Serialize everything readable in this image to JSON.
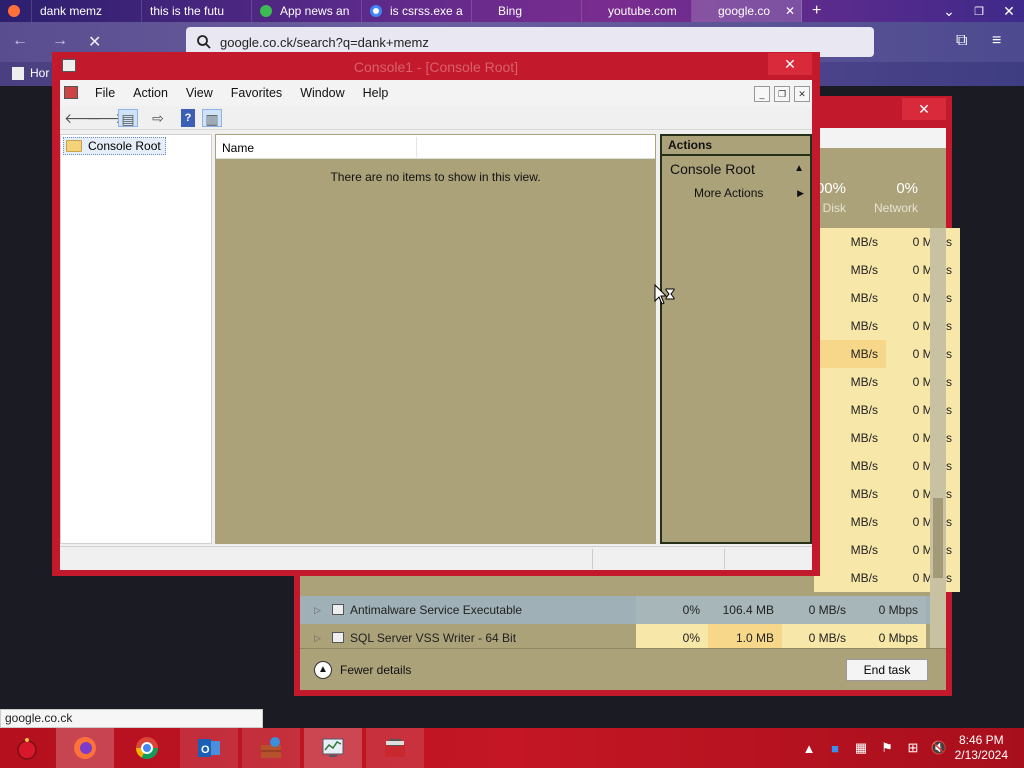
{
  "browser": {
    "tabs": [
      {
        "label": "",
        "icon": "firefox-icon",
        "color": "#ff7139"
      },
      {
        "label": "dank memz",
        "icon": "",
        "color": ""
      },
      {
        "label": "this is the futu",
        "icon": "",
        "color": ""
      },
      {
        "label": "App news an",
        "icon": "app-icon",
        "color": "#3cba54"
      },
      {
        "label": "is csrss.exe a",
        "icon": "google-icon",
        "color": "#4285f4"
      },
      {
        "label": "Bing",
        "icon": "",
        "color": ""
      },
      {
        "label": "youtube.com",
        "icon": "",
        "color": ""
      },
      {
        "label": "google.co",
        "icon": "",
        "color": "",
        "close": "✕"
      }
    ],
    "new_tab": "+",
    "url": "google.co.ck/search?q=dank+memz",
    "bookmark_label": "Hor",
    "status_url": "google.co.ck"
  },
  "task_manager": {
    "close": "✕",
    "columns": [
      {
        "value": "00%",
        "label": "Disk"
      },
      {
        "value": "0%",
        "label": "Network"
      }
    ],
    "partial_rows": [
      {
        "disk": "MB/s",
        "net": "0 Mbps"
      },
      {
        "disk": "MB/s",
        "net": "0 Mbps"
      },
      {
        "disk": "MB/s",
        "net": "0 Mbps"
      },
      {
        "disk": "MB/s",
        "net": "0 Mbps"
      },
      {
        "disk": "MB/s",
        "net": "0 Mbps"
      },
      {
        "disk": "MB/s",
        "net": "0 Mbps"
      },
      {
        "disk": "MB/s",
        "net": "0 Mbps"
      },
      {
        "disk": "MB/s",
        "net": "0 Mbps"
      },
      {
        "disk": "MB/s",
        "net": "0 Mbps"
      },
      {
        "disk": "MB/s",
        "net": "0 Mbps"
      },
      {
        "disk": "MB/s",
        "net": "0 Mbps"
      },
      {
        "disk": "MB/s",
        "net": "0 Mbps"
      },
      {
        "disk": "MB/s",
        "net": "0 Mbps"
      }
    ],
    "full_rows": [
      {
        "name": "Antimalware Service Executable",
        "cpu": "0%",
        "memory": "106.4 MB",
        "disk": "0 MB/s",
        "network": "0 Mbps"
      },
      {
        "name": "SQL Server VSS Writer - 64 Bit",
        "cpu": "0%",
        "memory": "1.0 MB",
        "disk": "0 MB/s",
        "network": "0 Mbps"
      }
    ],
    "fewer_details": "Fewer details",
    "end_task": "End task"
  },
  "console": {
    "title": "Console1 - [Console Root]",
    "close": "✕",
    "menu": [
      "File",
      "Action",
      "View",
      "Favorites",
      "Window",
      "Help"
    ],
    "tree_root": "Console Root",
    "list_column": "Name",
    "empty_message": "There are no items to show in this view.",
    "actions_header": "Actions",
    "actions_group": "Console Root",
    "actions_more": "More Actions"
  },
  "taskbar": {
    "time": "8:46 PM",
    "date": "2/13/2024"
  },
  "colors": {
    "window_frame": "#c21a2c",
    "content_bg": "#aba27a",
    "taskbar": "#b4101e"
  }
}
